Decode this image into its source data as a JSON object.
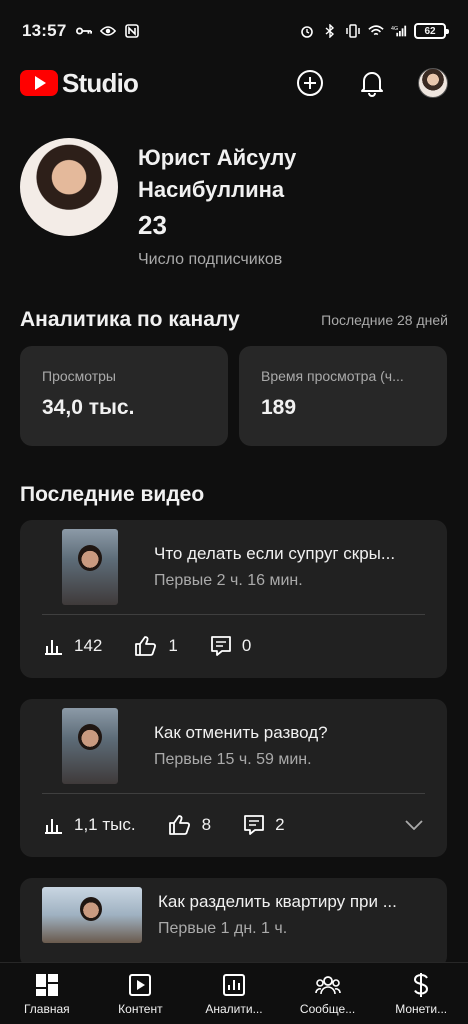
{
  "status_bar": {
    "time": "13:57",
    "battery": "62",
    "network": "4G"
  },
  "header": {
    "logo_text": "Studio"
  },
  "channel": {
    "name": "Юрист Айсулу Насибуллина",
    "subscribers": "23",
    "subscribers_label": "Число подписчиков"
  },
  "analytics": {
    "title": "Аналитика по каналу",
    "period": "Последние 28 дней",
    "cards": [
      {
        "label": "Просмотры",
        "value": "34,0 тыс."
      },
      {
        "label": "Время просмотра (ч...",
        "value": "189"
      }
    ]
  },
  "recent_videos": {
    "title": "Последние видео",
    "items": [
      {
        "title": "Что делать если супруг скры...",
        "subtitle": "Первые 2 ч. 16 мин.",
        "views": "142",
        "likes": "1",
        "comments": "0"
      },
      {
        "title": "Как отменить развод?",
        "subtitle": "Первые 15 ч. 59 мин.",
        "views": "1,1 тыс.",
        "likes": "8",
        "comments": "2"
      },
      {
        "title": "Как разделить квартиру при ...",
        "subtitle": "Первые 1 дн. 1 ч."
      }
    ]
  },
  "bottom_nav": [
    {
      "label": "Главная",
      "icon": "dashboard-icon"
    },
    {
      "label": "Контент",
      "icon": "content-icon"
    },
    {
      "label": "Аналити...",
      "icon": "analytics-icon"
    },
    {
      "label": "Сообще...",
      "icon": "community-icon"
    },
    {
      "label": "Монети...",
      "icon": "dollar-icon"
    }
  ],
  "colors": {
    "background": "#0f0f0f",
    "card": "#212121",
    "brand_red": "#ff0000"
  }
}
